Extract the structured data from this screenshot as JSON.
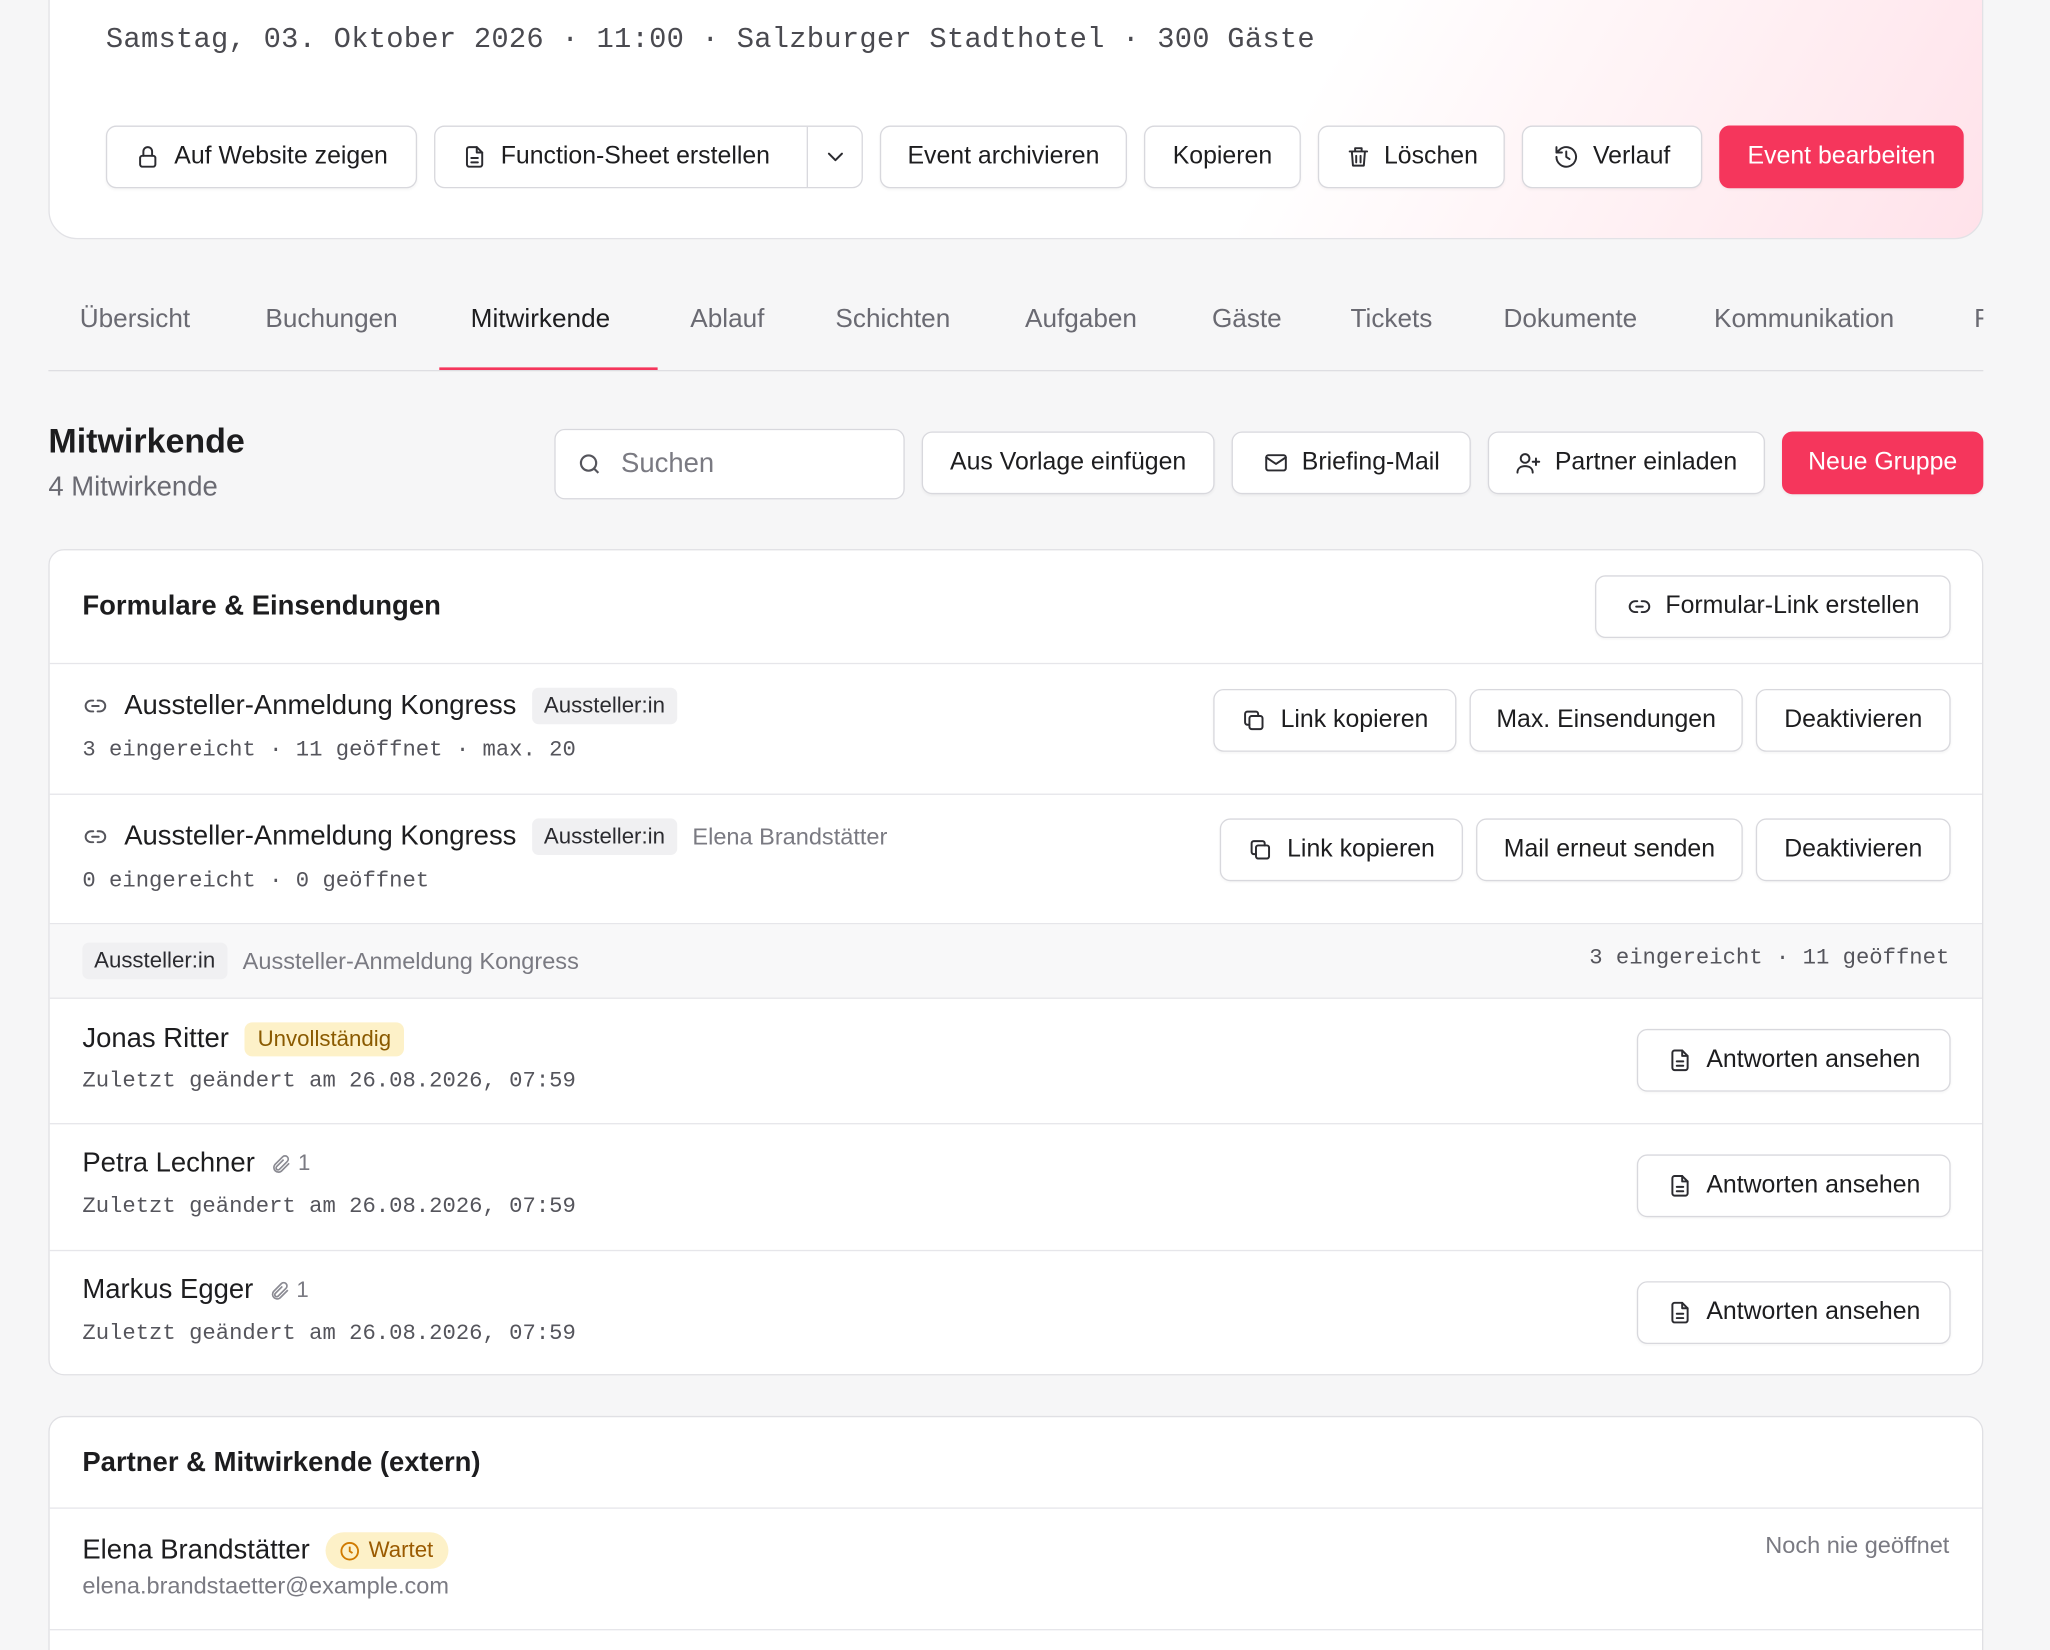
{
  "event": {
    "meta": "Samstag, 03. Oktober 2026 · 11:00 · Salzburger Stadthotel · 300 Gäste",
    "actions": {
      "show_on_website": "Auf Website zeigen",
      "function_sheet": "Function-Sheet erstellen",
      "archive": "Event archivieren",
      "copy": "Kopieren",
      "delete": "Löschen",
      "history": "Verlauf",
      "edit": "Event bearbeiten"
    }
  },
  "tabs": [
    "Übersicht",
    "Buchungen",
    "Mitwirkende",
    "Ablauf",
    "Schichten",
    "Aufgaben",
    "Gäste",
    "Tickets",
    "Dokumente",
    "Kommunikation",
    "F"
  ],
  "active_tab": "Mitwirkende",
  "section": {
    "title": "Mitwirkende",
    "count": "4 Mitwirkende",
    "search_placeholder": "Suchen",
    "actions": {
      "from_template": "Aus Vorlage einfügen",
      "briefing_mail": "Briefing-Mail",
      "invite_partner": "Partner einladen",
      "new_group": "Neue Gruppe"
    }
  },
  "forms_card": {
    "title": "Formulare & Einsendungen",
    "create_link": "Formular-Link erstellen",
    "links": [
      {
        "name": "Aussteller-Anmeldung Kongress",
        "tag": "Aussteller:in",
        "assignee": "",
        "stats": "3 eingereicht · 11 geöffnet · max. 20",
        "buttons": [
          "Link kopieren",
          "Max. Einsendungen",
          "Deaktivieren"
        ]
      },
      {
        "name": "Aussteller-Anmeldung Kongress",
        "tag": "Aussteller:in",
        "assignee": "Elena Brandstätter",
        "stats": "0 eingereicht · 0 geöffnet",
        "buttons": [
          "Link kopieren",
          "Mail erneut senden",
          "Deaktivieren"
        ]
      }
    ],
    "group": {
      "tag": "Aussteller:in",
      "name": "Aussteller-Anmeldung Kongress",
      "stats": "3 eingereicht · 11 geöffnet"
    },
    "submissions": [
      {
        "name": "Jonas Ritter",
        "badge": "Unvollständig",
        "attachments": "",
        "changed": "Zuletzt geändert am 26.08.2026, 07:59",
        "action": "Antworten ansehen"
      },
      {
        "name": "Petra Lechner",
        "badge": "",
        "attachments": "1",
        "changed": "Zuletzt geändert am 26.08.2026, 07:59",
        "action": "Antworten ansehen"
      },
      {
        "name": "Markus Egger",
        "badge": "",
        "attachments": "1",
        "changed": "Zuletzt geändert am 26.08.2026, 07:59",
        "action": "Antworten ansehen"
      }
    ]
  },
  "partners_card": {
    "title": "Partner & Mitwirkende (extern)",
    "partners": [
      {
        "name": "Elena Brandstätter",
        "status": "Wartet",
        "email": "elena.brandstaetter@example.com",
        "opened": "Noch nie geöffnet"
      }
    ]
  },
  "colors": {
    "accent": "#f5365c",
    "warn_bg": "#fdf1c8",
    "warn_text": "#8a5a00"
  }
}
